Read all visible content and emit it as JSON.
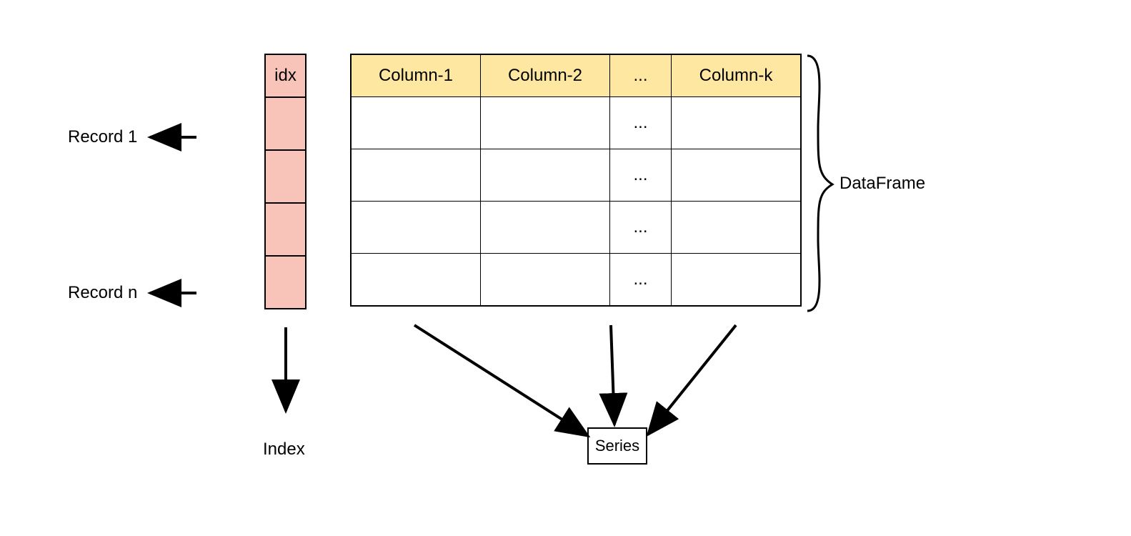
{
  "index": {
    "header": "idx",
    "rows": 4
  },
  "table": {
    "headers": [
      "Column-1",
      "Column-2",
      "...",
      "Column-k"
    ],
    "body": [
      [
        "",
        "",
        "...",
        ""
      ],
      [
        "",
        "",
        "...",
        ""
      ],
      [
        "",
        "",
        "...",
        ""
      ],
      [
        "",
        "",
        "...",
        ""
      ]
    ]
  },
  "labels": {
    "record1": "Record 1",
    "recordn": "Record n",
    "index": "Index",
    "dataframe": "DataFrame",
    "series": "Series"
  }
}
